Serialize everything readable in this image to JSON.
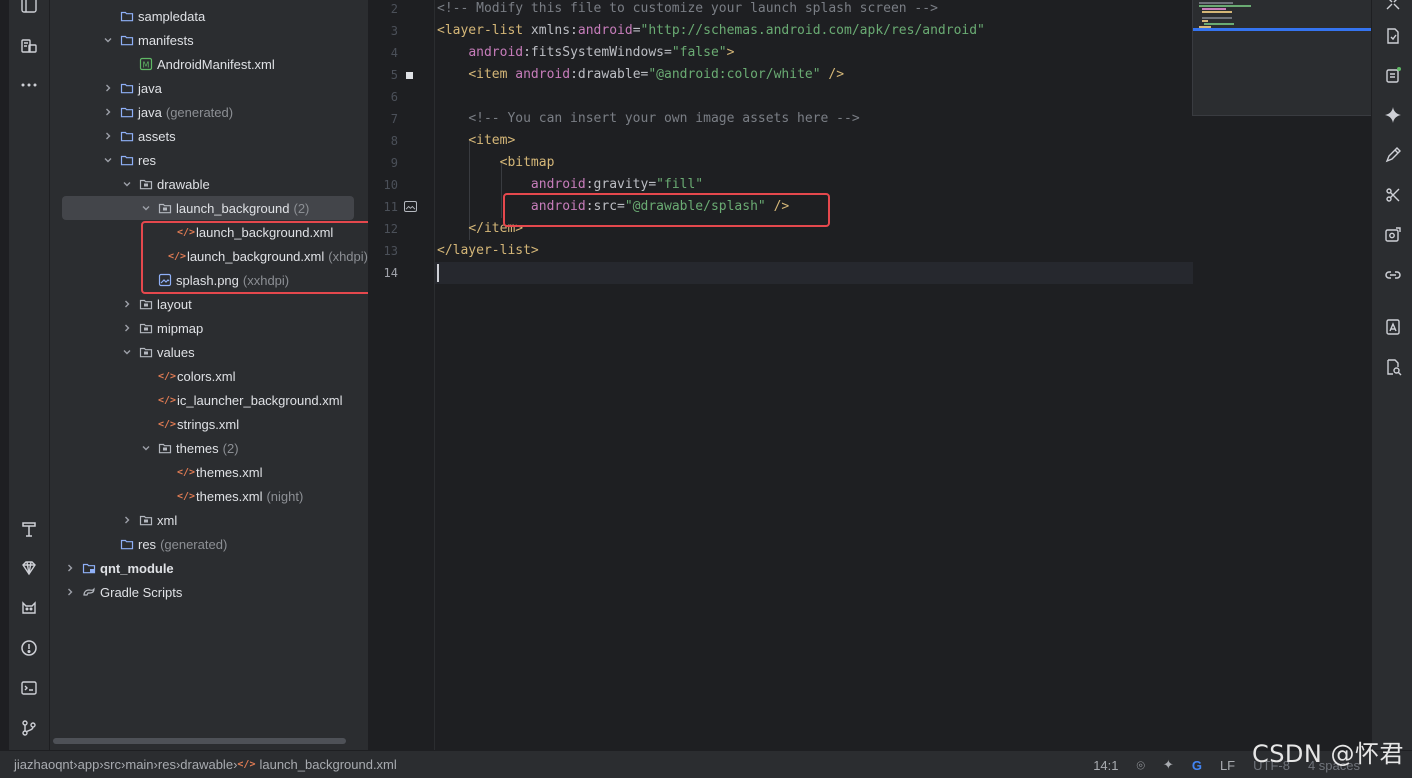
{
  "project_tree": [
    {
      "label": "sampledata",
      "hint": "",
      "indent": 2,
      "chevron": "none",
      "icon": "folder-icon"
    },
    {
      "label": "manifests",
      "hint": "",
      "indent": 2,
      "chevron": "down",
      "icon": "folder-icon"
    },
    {
      "label": "AndroidManifest.xml",
      "hint": "",
      "indent": 3,
      "chevron": "none",
      "icon": "manifest-file-icon"
    },
    {
      "label": "java",
      "hint": "",
      "indent": 2,
      "chevron": "right",
      "icon": "folder-icon"
    },
    {
      "label": "java",
      "hint": "(generated)",
      "indent": 2,
      "chevron": "right",
      "icon": "folder-icon"
    },
    {
      "label": "assets",
      "hint": "",
      "indent": 2,
      "chevron": "right",
      "icon": "folder-icon"
    },
    {
      "label": "res",
      "hint": "",
      "indent": 2,
      "chevron": "down",
      "icon": "folder-icon"
    },
    {
      "label": "drawable",
      "hint": "",
      "indent": 3,
      "chevron": "down",
      "icon": "package-folder-icon"
    },
    {
      "label": "launch_background",
      "hint": "(2)",
      "indent": 4,
      "chevron": "down",
      "icon": "package-folder-icon",
      "selected": true
    },
    {
      "label": "launch_background.xml",
      "hint": "",
      "indent": 5,
      "chevron": "none",
      "icon": "xml-file-icon"
    },
    {
      "label": "launch_background.xml",
      "hint": "(xhdpi)",
      "indent": 5,
      "chevron": "none",
      "icon": "xml-file-icon"
    },
    {
      "label": "splash.png",
      "hint": "(xxhdpi)",
      "indent": 4,
      "chevron": "none",
      "icon": "image-file-icon"
    },
    {
      "label": "layout",
      "hint": "",
      "indent": 3,
      "chevron": "right",
      "icon": "package-folder-icon"
    },
    {
      "label": "mipmap",
      "hint": "",
      "indent": 3,
      "chevron": "right",
      "icon": "package-folder-icon"
    },
    {
      "label": "values",
      "hint": "",
      "indent": 3,
      "chevron": "down",
      "icon": "package-folder-icon"
    },
    {
      "label": "colors.xml",
      "hint": "",
      "indent": 4,
      "chevron": "none",
      "icon": "xml-file-icon"
    },
    {
      "label": "ic_launcher_background.xml",
      "hint": "",
      "indent": 4,
      "chevron": "none",
      "icon": "xml-file-icon"
    },
    {
      "label": "strings.xml",
      "hint": "",
      "indent": 4,
      "chevron": "none",
      "icon": "xml-file-icon"
    },
    {
      "label": "themes",
      "hint": "(2)",
      "indent": 4,
      "chevron": "down",
      "icon": "package-folder-icon"
    },
    {
      "label": "themes.xml",
      "hint": "",
      "indent": 5,
      "chevron": "none",
      "icon": "xml-file-icon"
    },
    {
      "label": "themes.xml",
      "hint": "(night)",
      "indent": 5,
      "chevron": "none",
      "icon": "xml-file-icon"
    },
    {
      "label": "xml",
      "hint": "",
      "indent": 3,
      "chevron": "right",
      "icon": "package-folder-icon"
    },
    {
      "label": "res",
      "hint": "(generated)",
      "indent": 2,
      "chevron": "none",
      "icon": "folder-icon"
    },
    {
      "label": "qnt_module",
      "hint": "",
      "indent": 0,
      "chevron": "right",
      "icon": "module-folder-icon",
      "bold": true
    },
    {
      "label": "Gradle Scripts",
      "hint": "",
      "indent": 0,
      "chevron": "right",
      "icon": "gradle-icon"
    }
  ],
  "editor": {
    "line_numbers": [
      "2",
      "3",
      "4",
      "5",
      "6",
      "7",
      "8",
      "9",
      "10",
      "11",
      "12",
      "13",
      "14"
    ],
    "current_line": "14",
    "lines": [
      [
        [
          "com",
          "<!-- Modify this file to customize your launch splash screen -->"
        ]
      ],
      [
        [
          "tag",
          "<layer-list "
        ],
        [
          "attr",
          "xmlns:"
        ],
        [
          "ns",
          "android"
        ],
        [
          "pun",
          "="
        ],
        [
          "str",
          "\"http://schemas.android.com/apk/res/android\""
        ]
      ],
      [
        [
          "pun",
          "    "
        ],
        [
          "ns",
          "android"
        ],
        [
          "attr",
          ":fitsSystemWindows"
        ],
        [
          "pun",
          "="
        ],
        [
          "str",
          "\"false\""
        ],
        [
          "tag",
          ">"
        ]
      ],
      [
        [
          "pun",
          "    "
        ],
        [
          "tag",
          "<item "
        ],
        [
          "ns",
          "android"
        ],
        [
          "attr",
          ":drawable"
        ],
        [
          "pun",
          "="
        ],
        [
          "str",
          "\"@android:color/white\""
        ],
        [
          "tag",
          " />"
        ]
      ],
      [],
      [
        [
          "pun",
          "    "
        ],
        [
          "com",
          "<!-- You can insert your own image assets here -->"
        ]
      ],
      [
        [
          "pun",
          "    "
        ],
        [
          "tag",
          "<item>"
        ]
      ],
      [
        [
          "pun",
          "        "
        ],
        [
          "tag",
          "<bitmap"
        ]
      ],
      [
        [
          "pun",
          "            "
        ],
        [
          "ns",
          "android"
        ],
        [
          "attr",
          ":gravity"
        ],
        [
          "pun",
          "="
        ],
        [
          "str",
          "\"fill\""
        ]
      ],
      [
        [
          "pun",
          "            "
        ],
        [
          "ns",
          "android"
        ],
        [
          "attr",
          ":src"
        ],
        [
          "pun",
          "="
        ],
        [
          "str",
          "\"@drawable/splash\""
        ],
        [
          "tag",
          " />"
        ]
      ],
      [
        [
          "pun",
          "    "
        ],
        [
          "tag",
          "</item>"
        ]
      ],
      [
        [
          "tag",
          "</layer-list>"
        ]
      ],
      []
    ]
  },
  "breadcrumb": [
    "jiazhaoqnt",
    "app",
    "src",
    "main",
    "res",
    "drawable",
    "launch_background.xml"
  ],
  "status": {
    "position": "14:1",
    "line_ending": "LF",
    "encoding": "UTF-8",
    "indent": "4 spaces"
  },
  "watermark": "CSDN @怀君",
  "colors": {
    "callout": "#e5484d",
    "accent": "#3574f0"
  }
}
